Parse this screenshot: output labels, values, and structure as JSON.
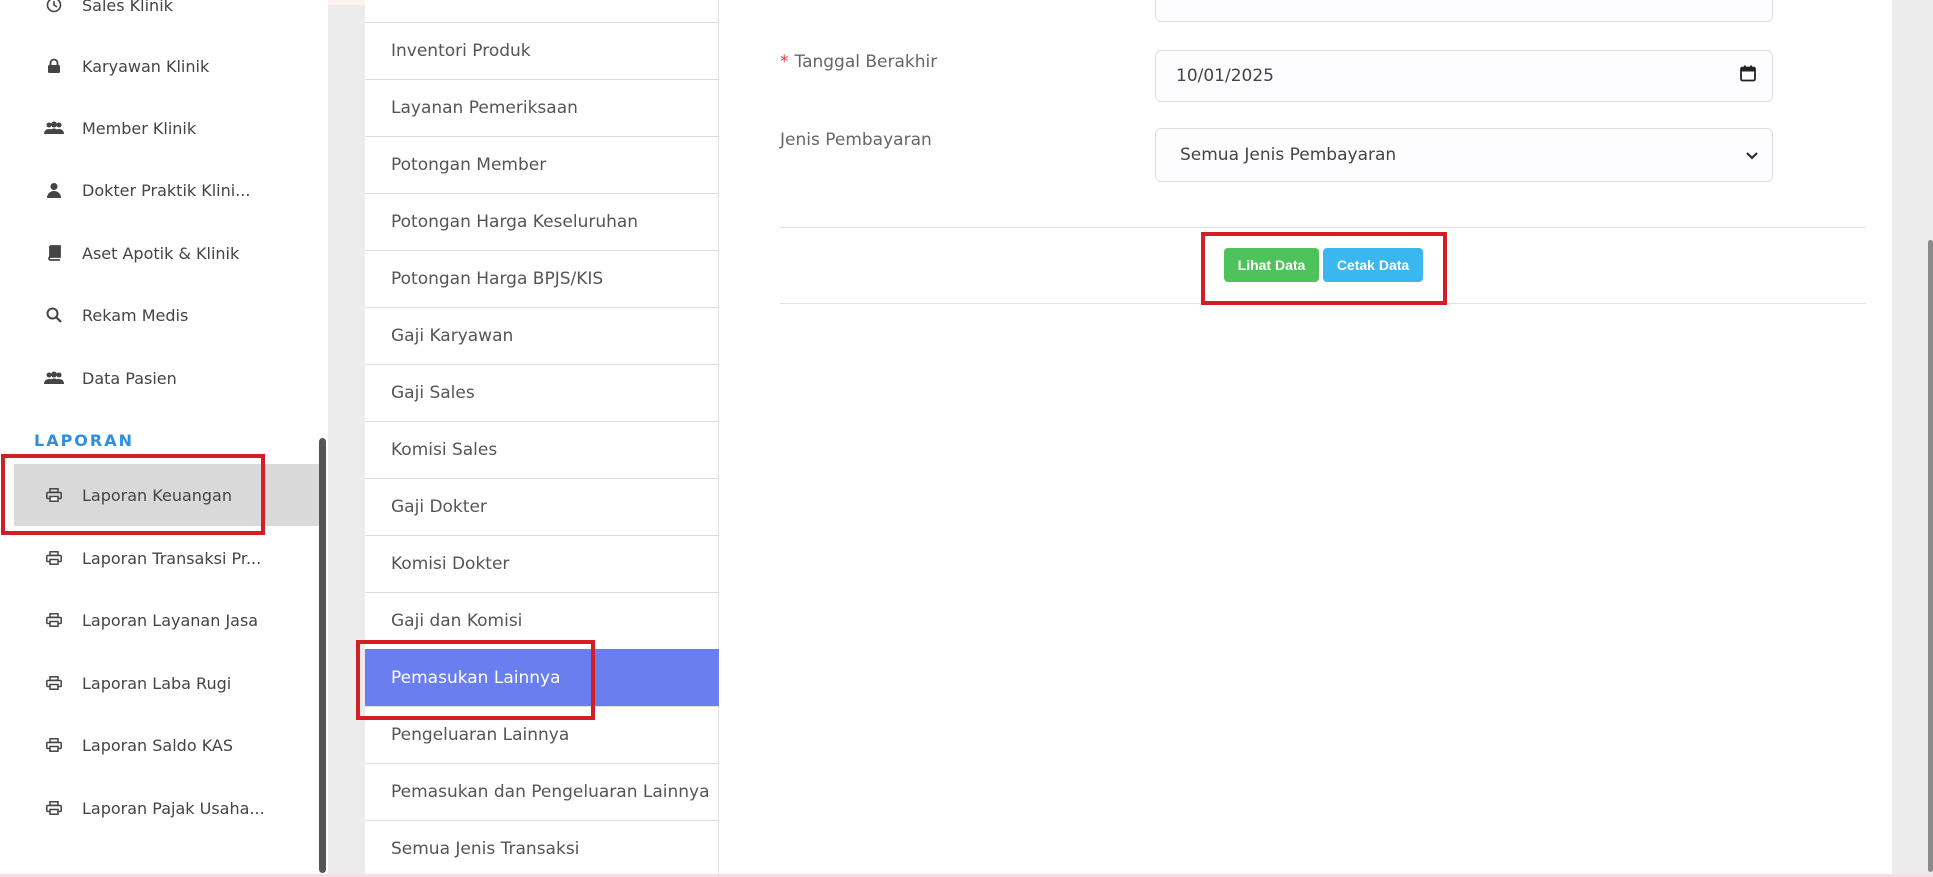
{
  "sidebar": {
    "items": [
      {
        "label": "Sales Klinik",
        "icon": "clock-icon"
      },
      {
        "label": "Karyawan Klinik",
        "icon": "lock-icon"
      },
      {
        "label": "Member Klinik",
        "icon": "users-icon"
      },
      {
        "label": "Dokter Praktik Klini...",
        "icon": "user-icon"
      },
      {
        "label": "Aset Apotik & Klinik",
        "icon": "book-icon"
      },
      {
        "label": "Rekam Medis",
        "icon": "search-icon"
      },
      {
        "label": "Data Pasien",
        "icon": "users-icon"
      }
    ],
    "section_title": "LAPORAN",
    "report_items": [
      {
        "label": "Laporan Keuangan",
        "icon": "printer-icon",
        "active": true
      },
      {
        "label": "Laporan Transaksi Pr...",
        "icon": "printer-icon"
      },
      {
        "label": "Laporan Layanan Jasa",
        "icon": "printer-icon"
      },
      {
        "label": "Laporan Laba Rugi",
        "icon": "printer-icon"
      },
      {
        "label": "Laporan Saldo KAS",
        "icon": "printer-icon"
      },
      {
        "label": "Laporan Pajak Usaha...",
        "icon": "printer-icon"
      }
    ]
  },
  "menu": {
    "items": [
      "Inventori Produk",
      "Layanan Pemeriksaan",
      "Potongan Member",
      "Potongan Harga Keseluruhan",
      "Potongan Harga BPJS/KIS",
      "Gaji Karyawan",
      "Gaji Sales",
      "Komisi Sales",
      "Gaji Dokter",
      "Komisi Dokter",
      "Gaji dan Komisi",
      "Pemasukan Lainnya",
      "Pengeluaran Lainnya",
      "Pemasukan dan Pengeluaran Lainnya",
      "Semua Jenis Transaksi"
    ],
    "active": "Pemasukan Lainnya"
  },
  "form": {
    "required_mark": "*",
    "end_date_label": "Tanggal Berakhir",
    "end_date_value": "10/01/2025",
    "payment_type_label": "Jenis Pembayaran",
    "payment_type_value": "Semua Jenis Pembayaran"
  },
  "actions": {
    "view_label": "Lihat Data",
    "print_label": "Cetak Data"
  },
  "colors": {
    "active_menu": "#6a7ef0",
    "highlight": "#d21f26",
    "section": "#2e8fe0",
    "view_button": "#4fc35b",
    "print_button": "#3ab7ee"
  }
}
